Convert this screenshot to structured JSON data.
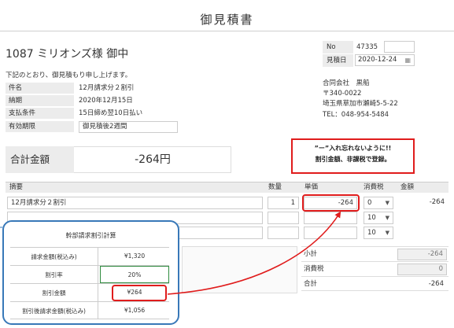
{
  "title": "御見積書",
  "customer": "1087 ミリオンズ様 御中",
  "intro": "下記のとおり、御見積もり申し上げます。",
  "info": {
    "subject_label": "件名",
    "subject": "12月請求分２割引",
    "delivery_label": "納期",
    "delivery": "2020年12月15日",
    "payment_label": "支払条件",
    "payment": "15日締め翌10日払い",
    "validity_label": "有効期限",
    "validity": "御見積後2週間"
  },
  "meta": {
    "no_label": "No",
    "no": "47335",
    "date_label": "見積日",
    "date": "2020-12-24"
  },
  "company": {
    "name": "合同会社　黒船",
    "postal": "〒340-0022",
    "address": "埼玉県草加市瀬崎5-5-22",
    "tel": "TEL：048-954-5484"
  },
  "total": {
    "label": "合計金額",
    "value": "-264円"
  },
  "callout": {
    "line1": "”ー”入れ忘れないように!!",
    "line2": "割引金額、非課税で登録。"
  },
  "table": {
    "headers": {
      "desc": "摘要",
      "qty": "数量",
      "price": "単価",
      "tax": "消費税",
      "amount": "金額"
    },
    "rows": [
      {
        "desc": "12月請求分２割引",
        "qty": "1",
        "price": "-264",
        "tax": "0",
        "amount": "-264"
      },
      {
        "desc": "",
        "qty": "",
        "price": "",
        "tax": "10",
        "amount": ""
      },
      {
        "desc": "",
        "qty": "",
        "price": "",
        "tax": "10",
        "amount": ""
      }
    ]
  },
  "summary": {
    "subtotal_label": "小計",
    "subtotal": "-264",
    "tax_label": "消費税",
    "tax": "0",
    "total_label": "合計",
    "total": "-264"
  },
  "panel": {
    "title": "幹部請求割引計算",
    "rows": [
      {
        "label": "請求金額(税込み)",
        "value": "¥1,320"
      },
      {
        "label": "割引率",
        "value": "20%"
      },
      {
        "label": "割引金額",
        "value": "¥264"
      },
      {
        "label": "割引後請求金額(税込み)",
        "value": "¥1,056"
      }
    ]
  },
  "colors": {
    "highlight_red": "#e01c1c",
    "panel_blue": "#3878b8",
    "accent_green": "#2e8b3e"
  }
}
